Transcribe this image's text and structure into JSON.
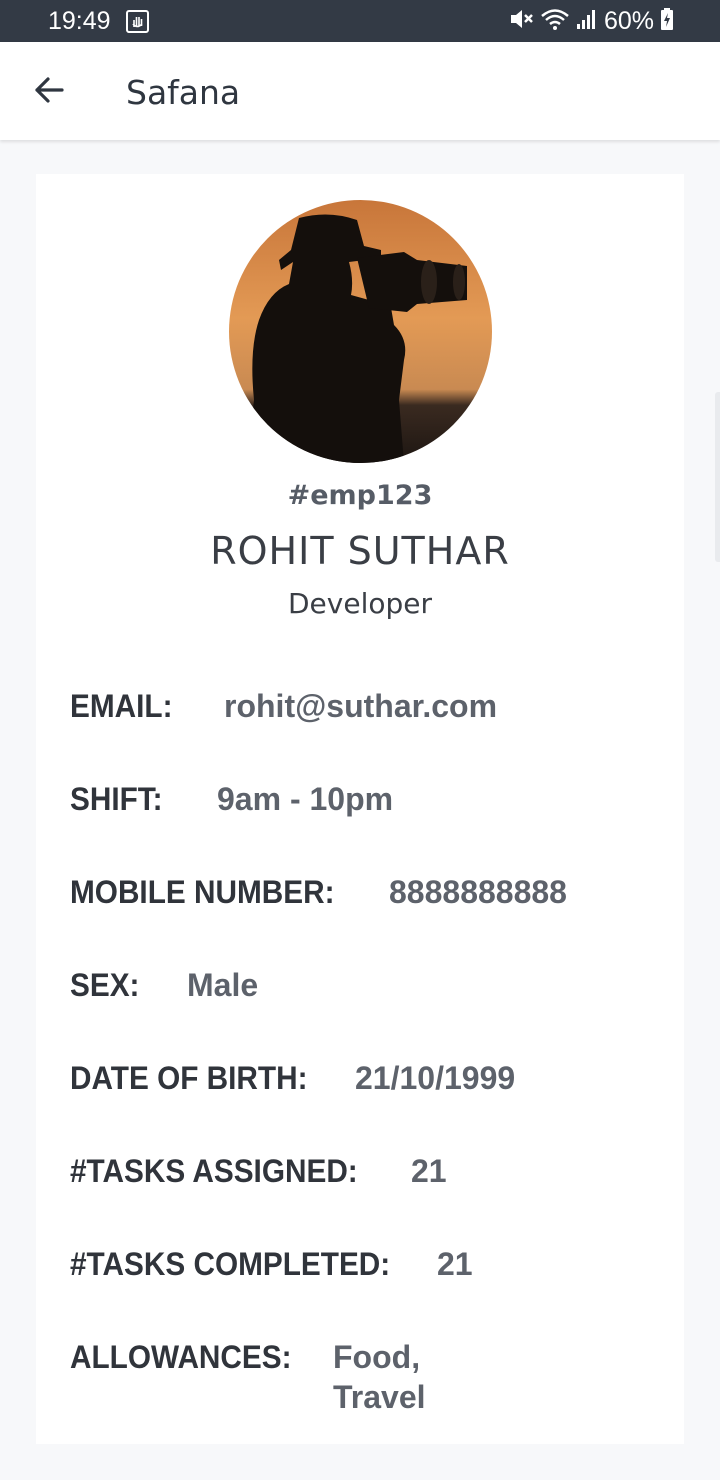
{
  "status_bar": {
    "time": "19:49",
    "battery": "60%",
    "icons": [
      "screenshot-notification-icon",
      "mute-icon",
      "wifi-icon",
      "signal-icon",
      "battery-charging-icon"
    ]
  },
  "app_bar": {
    "back_icon": "arrow-left-icon",
    "title": "Safana"
  },
  "profile": {
    "employee_id": "#emp123",
    "name": "ROHIT SUTHAR",
    "role": "Developer"
  },
  "fields": [
    {
      "label": "EMAIL:",
      "value": "rohit@suthar.com"
    },
    {
      "label": "SHIFT:",
      "value": "9am - 10pm"
    },
    {
      "label": "MOBILE NUMBER:",
      "value": "8888888888"
    },
    {
      "label": "SEX:",
      "value": "Male"
    },
    {
      "label": "DATE OF BIRTH:",
      "value": "21/10/1999"
    },
    {
      "label": "#TASKS ASSIGNED:",
      "value": "21"
    },
    {
      "label": "#TASKS COMPLETED:",
      "value": "21"
    },
    {
      "label": "ALLOWANCES:",
      "value_lines": [
        "Food,",
        "Travel"
      ]
    }
  ],
  "colors": {
    "status_bar": "#333a45",
    "app_bar": "#ffffff",
    "background": "#f7f8fa",
    "label": "#30343b",
    "value": "#5d626b"
  }
}
